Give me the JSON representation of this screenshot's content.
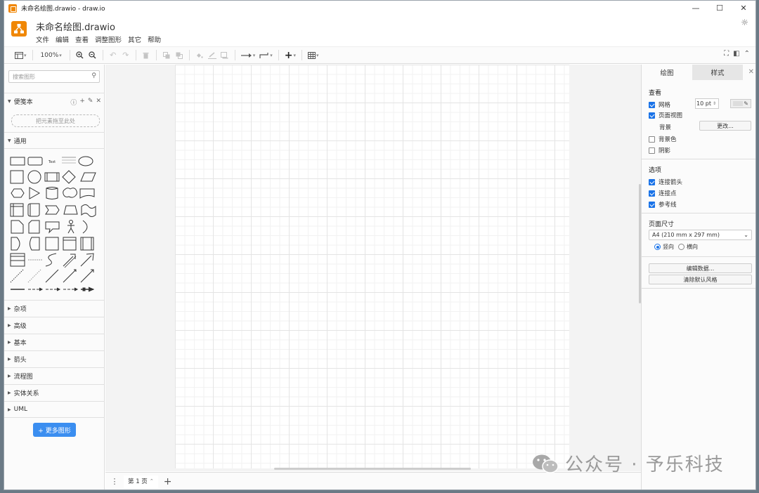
{
  "window": {
    "title": "未命名绘图.drawio - draw.io"
  },
  "window_controls": {
    "minimize": "—",
    "maximize": "☐",
    "close": "✕"
  },
  "header": {
    "doc_title": "未命名绘图.drawio",
    "theme_icon": "☼"
  },
  "menu": [
    "文件",
    "编辑",
    "查看",
    "调整图形",
    "其它",
    "帮助"
  ],
  "toolbar": {
    "zoom": "100%"
  },
  "left": {
    "search_placeholder": "搜索图形",
    "scratchpad": "便笺本",
    "dropzone": "把元素拖至此处",
    "general": "通用",
    "sections": [
      "杂项",
      "高级",
      "基本",
      "箭头",
      "流程图",
      "实体关系",
      "UML"
    ],
    "more_shapes": "+ 更多图形"
  },
  "pagebar": {
    "page_tab": "第 1 页"
  },
  "right": {
    "tabs": [
      "绘图",
      "样式"
    ],
    "view_title": "查看",
    "grid": {
      "label": "网格",
      "checked": true,
      "size": "10 pt"
    },
    "page_view": {
      "label": "页面视图",
      "checked": true
    },
    "background": {
      "label": "背景",
      "button": "更改..."
    },
    "background_color": {
      "label": "背景色",
      "checked": false
    },
    "shadow": {
      "label": "阴影",
      "checked": false
    },
    "options_title": "选项",
    "connection_arrows": {
      "label": "连接箭头",
      "checked": true
    },
    "connection_points": {
      "label": "连接点",
      "checked": true
    },
    "guides": {
      "label": "参考线",
      "checked": true
    },
    "page_size_title": "页面尺寸",
    "page_size": "A4 (210 mm x 297 mm)",
    "orientation": {
      "portrait": "竖向",
      "landscape": "横向",
      "selected": "portrait"
    },
    "edit_data": "编辑数据...",
    "clear_style": "清除默认风格"
  },
  "watermark": {
    "text": "公众号 · 予乐科技"
  },
  "colors": {
    "accent": "#1a73e8",
    "brand": "#f08705",
    "button": "#3b8ef0"
  }
}
